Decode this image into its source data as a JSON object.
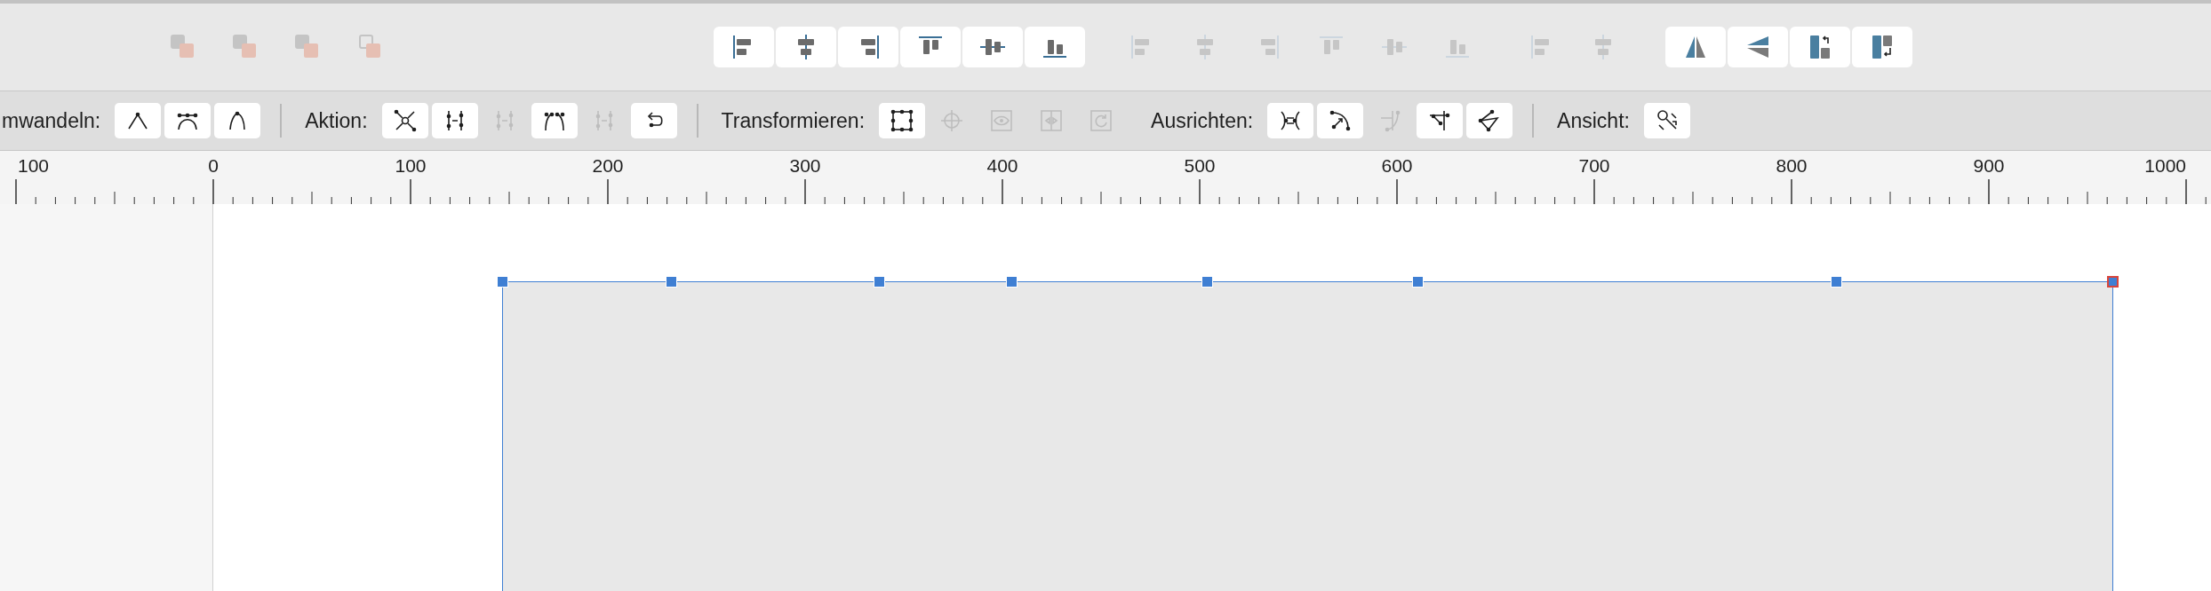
{
  "toolbar": {
    "groups": [
      {
        "items": [
          {
            "disabled": true
          },
          {
            "disabled": true
          },
          {
            "disabled": true
          },
          {
            "disabled": true
          }
        ]
      },
      {
        "items": [
          {
            "disabled": false
          },
          {
            "disabled": false
          },
          {
            "disabled": false
          },
          {
            "disabled": false
          },
          {
            "disabled": false
          },
          {
            "disabled": false
          }
        ]
      },
      {
        "items": [
          {
            "disabled": true
          },
          {
            "disabled": true
          },
          {
            "disabled": true
          },
          {
            "disabled": true
          },
          {
            "disabled": true
          },
          {
            "disabled": true
          }
        ]
      },
      {
        "items": [
          {
            "disabled": true
          },
          {
            "disabled": true
          }
        ]
      },
      {
        "items": [
          {
            "disabled": false
          },
          {
            "disabled": false
          },
          {
            "disabled": false
          },
          {
            "disabled": false
          }
        ]
      }
    ]
  },
  "node_bar": {
    "sections": [
      {
        "label": "mwandeln:",
        "separator": true,
        "buttons": [
          {
            "disabled": false
          },
          {
            "disabled": false
          },
          {
            "disabled": false
          }
        ]
      },
      {
        "label": "Aktion:",
        "separator": true,
        "buttons": [
          {
            "disabled": false
          },
          {
            "disabled": false
          },
          {
            "disabled": true
          },
          {
            "disabled": false
          },
          {
            "disabled": true
          },
          {
            "disabled": false
          }
        ]
      },
      {
        "label": "Transformieren:",
        "separator": false,
        "buttons": [
          {
            "disabled": false
          },
          {
            "disabled": true
          },
          {
            "disabled": true
          },
          {
            "disabled": true
          },
          {
            "disabled": true
          }
        ]
      },
      {
        "label": "Ausrichten:",
        "separator": true,
        "buttons": [
          {
            "disabled": false
          },
          {
            "disabled": false
          },
          {
            "disabled": true
          },
          {
            "disabled": false
          },
          {
            "disabled": false
          }
        ]
      },
      {
        "label": "Ansicht:",
        "separator": false,
        "buttons": [
          {
            "disabled": false
          }
        ]
      }
    ]
  },
  "ruler": {
    "labels": [
      "100",
      "0",
      "100",
      "200",
      "300",
      "400",
      "500",
      "600",
      "700",
      "800",
      "900",
      "1000"
    ]
  },
  "canvas": {
    "handles": [
      {
        "selected": false
      },
      {
        "selected": false
      },
      {
        "selected": false
      },
      {
        "selected": false
      },
      {
        "selected": false
      },
      {
        "selected": false
      },
      {
        "selected": false
      },
      {
        "selected": true
      }
    ]
  }
}
